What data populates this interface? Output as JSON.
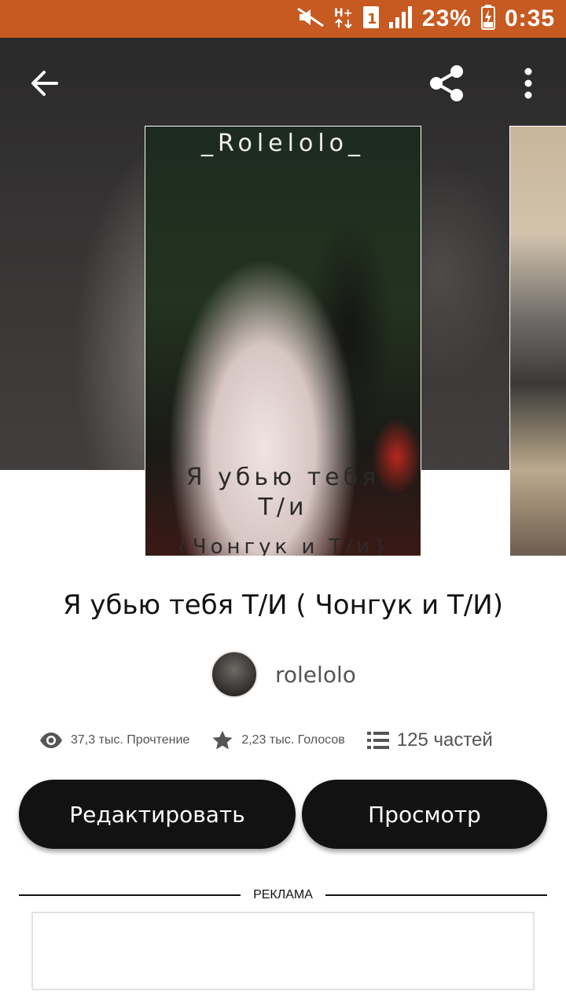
{
  "status_bar": {
    "battery_percent": "23%",
    "time": "0:35",
    "icons": [
      "mute-icon",
      "network-hplus-icon",
      "sim-1-icon",
      "signal-icon",
      "battery-charging-icon"
    ],
    "background_color": "#c65a21"
  },
  "toolbar": {
    "back_icon": "arrow-left-icon",
    "share_icon": "share-icon",
    "more_icon": "more-vertical-icon"
  },
  "cover": {
    "top_text": "_Rolelolo_",
    "title_line1": "Я убью тебя",
    "title_line2": "Т/и",
    "subtitle": "{Чонгук и Т/и}"
  },
  "book": {
    "title": "Я убью тебя Т/И ( Чонгук и Т/И)",
    "author": "rolelolo"
  },
  "stats": {
    "reads": "37,3 тыс. Прочтение",
    "votes": "2,23 тыс. Голосов",
    "parts": "125 частей"
  },
  "actions": {
    "edit_label": "Редактировать",
    "view_label": "Просмотр"
  },
  "ad": {
    "label": "РЕКЛАМА"
  }
}
